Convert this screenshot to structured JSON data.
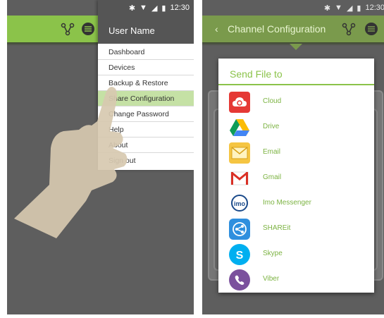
{
  "status": {
    "time": "12:30"
  },
  "left": {
    "drawer": {
      "user_name": "User Name",
      "items": [
        {
          "label": "Dashboard"
        },
        {
          "label": "Devices"
        },
        {
          "label": "Backup & Restore"
        },
        {
          "label": "Share Configuration"
        },
        {
          "label": "Change Password"
        },
        {
          "label": "Help"
        },
        {
          "label": "About"
        },
        {
          "label": "Sign out"
        }
      ],
      "active_item": "Share Configuration"
    }
  },
  "right": {
    "app_title": "Channel Configuration",
    "dialog": {
      "title": "Send File to",
      "targets": [
        {
          "label": "Cloud",
          "icon": "cloud-icon",
          "color": "#e53935"
        },
        {
          "label": "Drive",
          "icon": "drive-icon",
          "color": "#ffffff"
        },
        {
          "label": "Email",
          "icon": "email-icon",
          "color": "#f5c542"
        },
        {
          "label": "Gmail",
          "icon": "gmail-icon",
          "color": "#ffffff"
        },
        {
          "label": "Imo Messenger",
          "icon": "imo-icon",
          "color": "#ffffff"
        },
        {
          "label": "SHAREit",
          "icon": "shareit-icon",
          "color": "#2f8fde"
        },
        {
          "label": "Skype",
          "icon": "skype-icon",
          "color": "#00aff0"
        },
        {
          "label": "Viber",
          "icon": "viber-icon",
          "color": "#7b519d"
        }
      ]
    }
  },
  "colors": {
    "accent": "#8bc34a",
    "background": "#5e5e5e"
  }
}
